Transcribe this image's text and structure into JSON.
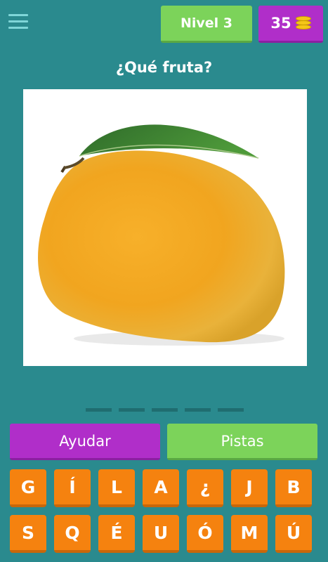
{
  "header": {
    "level_label": "Nivel 3",
    "coins": "35",
    "coin_icon": "coin-stack-icon",
    "menu_icon": "hamburger-menu-icon"
  },
  "question": "¿Qué fruta?",
  "image": {
    "subject": "mango"
  },
  "answer_slots": 5,
  "buttons": {
    "help_label": "Ayudar",
    "hints_label": "Pistas"
  },
  "keyboard": {
    "row1": [
      "G",
      "Í",
      "L",
      "A",
      "¿",
      "J",
      "B"
    ],
    "row2": [
      "S",
      "Q",
      "É",
      "U",
      "Ó",
      "M",
      "Ú"
    ]
  },
  "colors": {
    "background": "#2a8a8e",
    "level_badge": "#7cd35a",
    "coin_badge": "#b02ec9",
    "key": "#f5820f",
    "help_button": "#b02ec9",
    "hints_button": "#7cd35a"
  }
}
